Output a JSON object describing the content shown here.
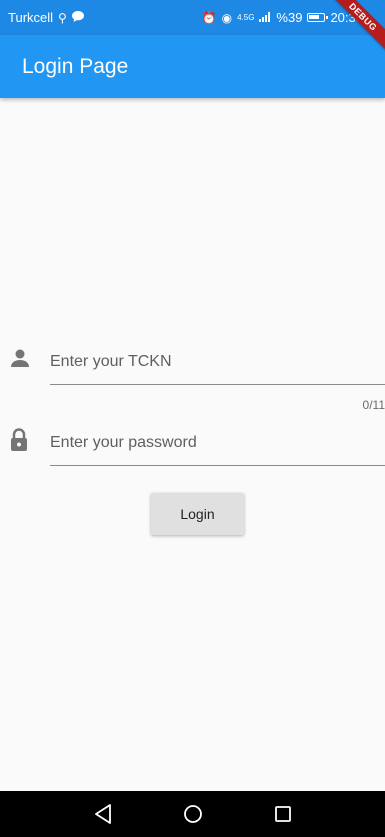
{
  "status_bar": {
    "carrier": "Turkcell",
    "network": "4.5G",
    "battery": "%39",
    "time": "20:35"
  },
  "debug_banner": "DEBUG",
  "app_bar": {
    "title": "Login Page"
  },
  "form": {
    "tckn": {
      "placeholder": "Enter your TCKN",
      "counter": "0/11"
    },
    "password": {
      "placeholder": "Enter your password"
    },
    "login_label": "Login"
  },
  "colors": {
    "app_bar": "#2196f3",
    "status_bar": "#1e88e5",
    "background": "#fafafa",
    "button": "#e0e0e0",
    "icon": "#757575"
  },
  "icons": {
    "person": "person-icon",
    "lock": "lock-icon",
    "back": "back-triangle-icon",
    "home": "home-circle-icon",
    "recents": "recents-square-icon"
  }
}
